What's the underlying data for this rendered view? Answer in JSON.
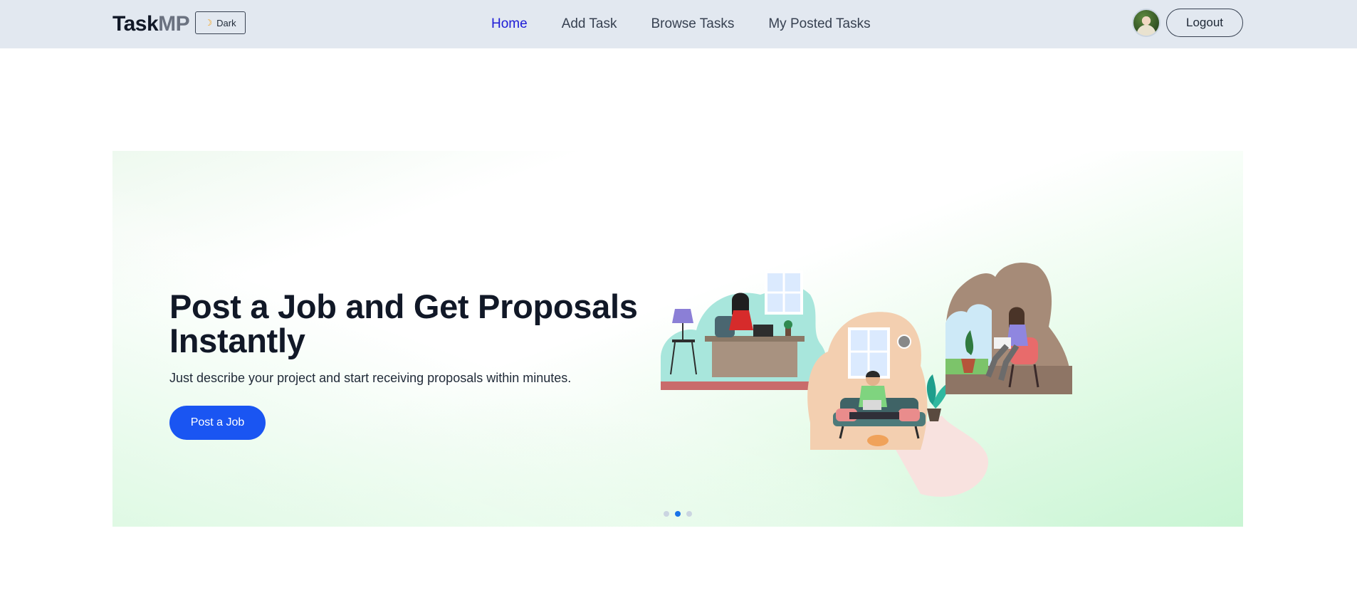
{
  "navbar": {
    "brand": {
      "part1": "Task",
      "part2": "MP"
    },
    "theme_toggle": {
      "icon": "moon-icon",
      "label": "Dark"
    },
    "links": [
      {
        "label": "Home",
        "active": true
      },
      {
        "label": "Add Task",
        "active": false
      },
      {
        "label": "Browse Tasks",
        "active": false
      },
      {
        "label": "My Posted Tasks",
        "active": false
      }
    ],
    "logout_label": "Logout"
  },
  "hero": {
    "title": "Post a Job and Get Proposals Instantly",
    "subtitle": "Just describe your project and start receiving proposals within minutes.",
    "cta_label": "Post a Job",
    "slides_count": 3,
    "active_slide": 2
  },
  "colors": {
    "navbar_bg": "#e2e8f0",
    "active_link": "#1d1bd6",
    "cta_bg": "#1a55f2",
    "active_dot": "#1a73e8"
  }
}
